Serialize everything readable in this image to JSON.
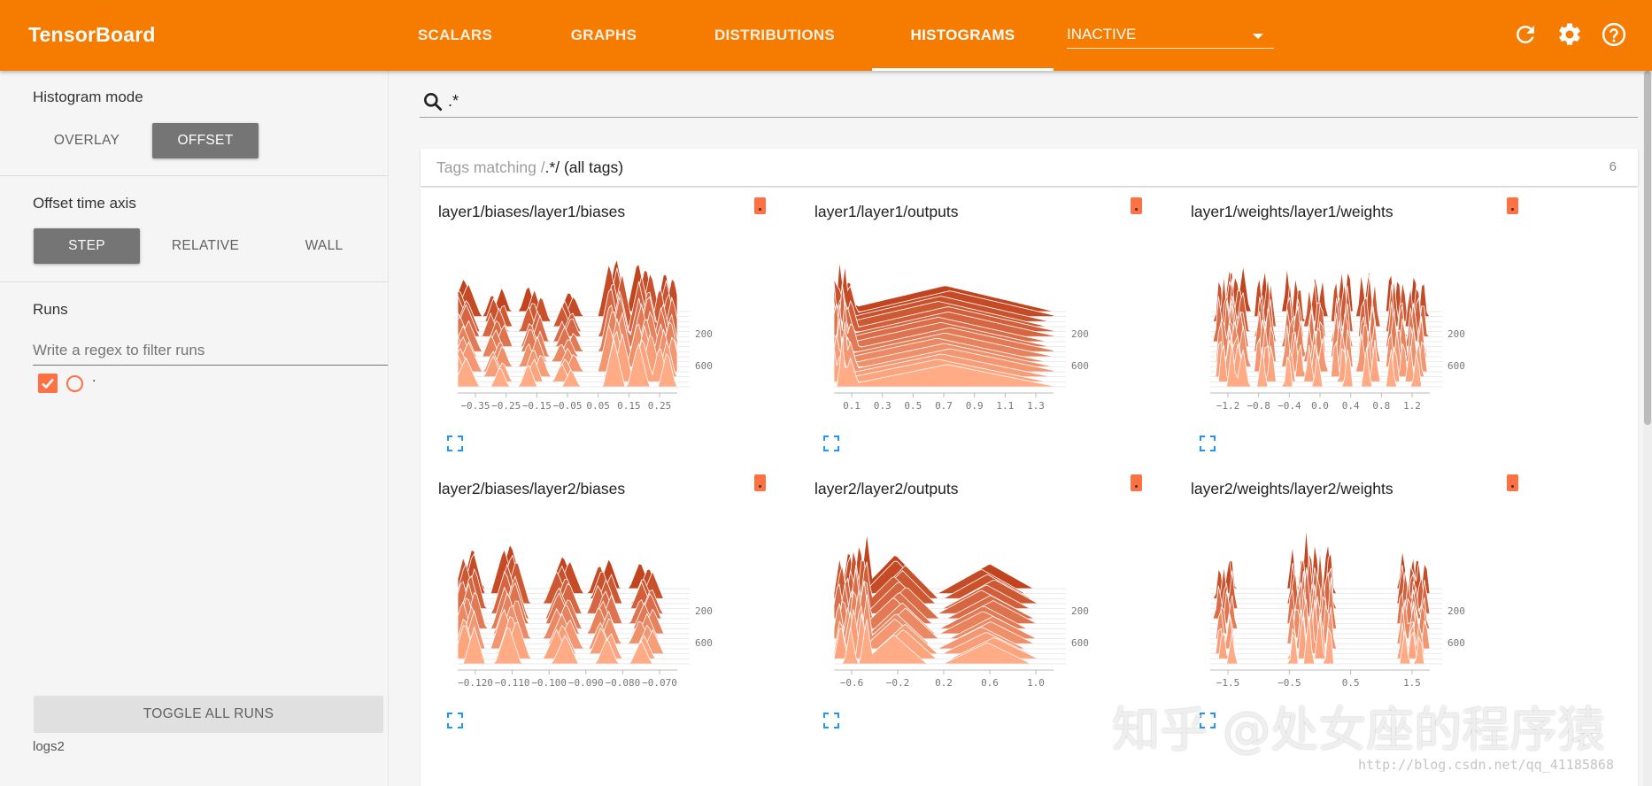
{
  "app": {
    "brand": "TensorBoard"
  },
  "nav": {
    "tabs": [
      {
        "label": "SCALARS",
        "active": false
      },
      {
        "label": "GRAPHS",
        "active": false
      },
      {
        "label": "DISTRIBUTIONS",
        "active": false
      },
      {
        "label": "HISTOGRAMS",
        "active": true
      }
    ],
    "inactive_select": "INACTIVE",
    "icons": [
      "refresh-icon",
      "settings-icon",
      "help-icon"
    ]
  },
  "sidebar": {
    "histogram_mode": {
      "title": "Histogram mode",
      "options": [
        "OVERLAY",
        "OFFSET"
      ],
      "selected": "OFFSET"
    },
    "offset_axis": {
      "title": "Offset time axis",
      "options": [
        "STEP",
        "RELATIVE",
        "WALL"
      ],
      "selected": "STEP"
    },
    "runs": {
      "title": "Runs",
      "filter_placeholder": "Write a regex to filter runs",
      "items": [
        {
          "label": ".",
          "checked": true
        }
      ],
      "toggle_label": "TOGGLE ALL RUNS",
      "logdir": "logs2"
    }
  },
  "main": {
    "search": {
      "query": ".*"
    },
    "category": {
      "prefix": "Tags matching /",
      "regex": ".*",
      "suffix": "/ (all tags)",
      "count": "6"
    },
    "cards": [
      {
        "title": "layer1/biases/layer1/biases",
        "xticks": [
          "−0.35",
          "−0.25",
          "−0.15",
          "−0.05",
          "0.05",
          "0.15",
          "0.25"
        ],
        "yticks": [
          "200",
          "600"
        ]
      },
      {
        "title": "layer1/layer1/outputs",
        "xticks": [
          "0.1",
          "0.3",
          "0.5",
          "0.7",
          "0.9",
          "1.1",
          "1.3"
        ],
        "yticks": [
          "200",
          "600"
        ]
      },
      {
        "title": "layer1/weights/layer1/weights",
        "xticks": [
          "−1.2",
          "−0.8",
          "−0.4",
          "0.0",
          "0.4",
          "0.8",
          "1.2"
        ],
        "yticks": [
          "200",
          "600"
        ]
      },
      {
        "title": "layer2/biases/layer2/biases",
        "xticks": [
          "−0.120",
          "−0.110",
          "−0.100",
          "−0.090",
          "−0.080",
          "−0.070"
        ],
        "yticks": [
          "200",
          "600"
        ]
      },
      {
        "title": "layer2/layer2/outputs",
        "xticks": [
          "−0.6",
          "−0.2",
          "0.2",
          "0.6",
          "1.0"
        ],
        "yticks": [
          "200",
          "600"
        ]
      },
      {
        "title": "layer2/weights/layer2/weights",
        "xticks": [
          "−1.5",
          "−0.5",
          "0.5",
          "1.5"
        ],
        "yticks": [
          "200",
          "600"
        ]
      }
    ]
  },
  "watermark": {
    "text": "知乎 @处女座的程序猿",
    "url": "http://blog.csdn.net/qq_41185868"
  },
  "colors": {
    "header": "#f57c00",
    "accent": "#ff7043",
    "dark": "#c1441f",
    "light": "#ffab85"
  }
}
